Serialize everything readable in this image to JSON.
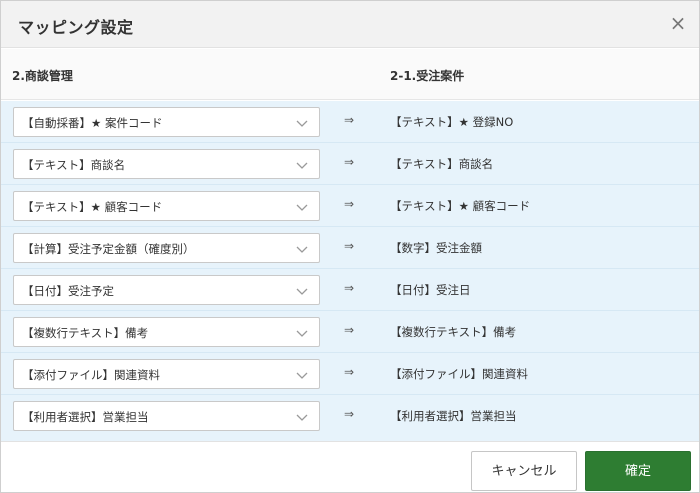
{
  "dialog": {
    "title": "マッピング設定",
    "close_icon": "close-icon"
  },
  "columns": {
    "left": "2.商談管理",
    "right": "2-1.受注案件"
  },
  "arrow_symbol": "⇒",
  "mappings": [
    {
      "source": "【自動採番】★ 案件コード",
      "target": "【テキスト】★ 登録NO"
    },
    {
      "source": "【テキスト】商談名",
      "target": "【テキスト】商談名"
    },
    {
      "source": "【テキスト】★ 顧客コード",
      "target": "【テキスト】★ 顧客コード"
    },
    {
      "source": "【計算】受注予定金額（確度別）",
      "target": "【数字】受注金額"
    },
    {
      "source": "【日付】受注予定",
      "target": "【日付】受注日"
    },
    {
      "source": "【複数行テキスト】備考",
      "target": "【複数行テキスト】備考"
    },
    {
      "source": "【添付ファイル】関連資料",
      "target": "【添付ファイル】関連資料"
    },
    {
      "source": "【利用者選択】営業担当",
      "target": "【利用者選択】営業担当"
    }
  ],
  "footer": {
    "cancel_label": "キャンセル",
    "confirm_label": "確定"
  },
  "colors": {
    "accent": "#2e7d32",
    "row_background": "#e7f3fb"
  }
}
